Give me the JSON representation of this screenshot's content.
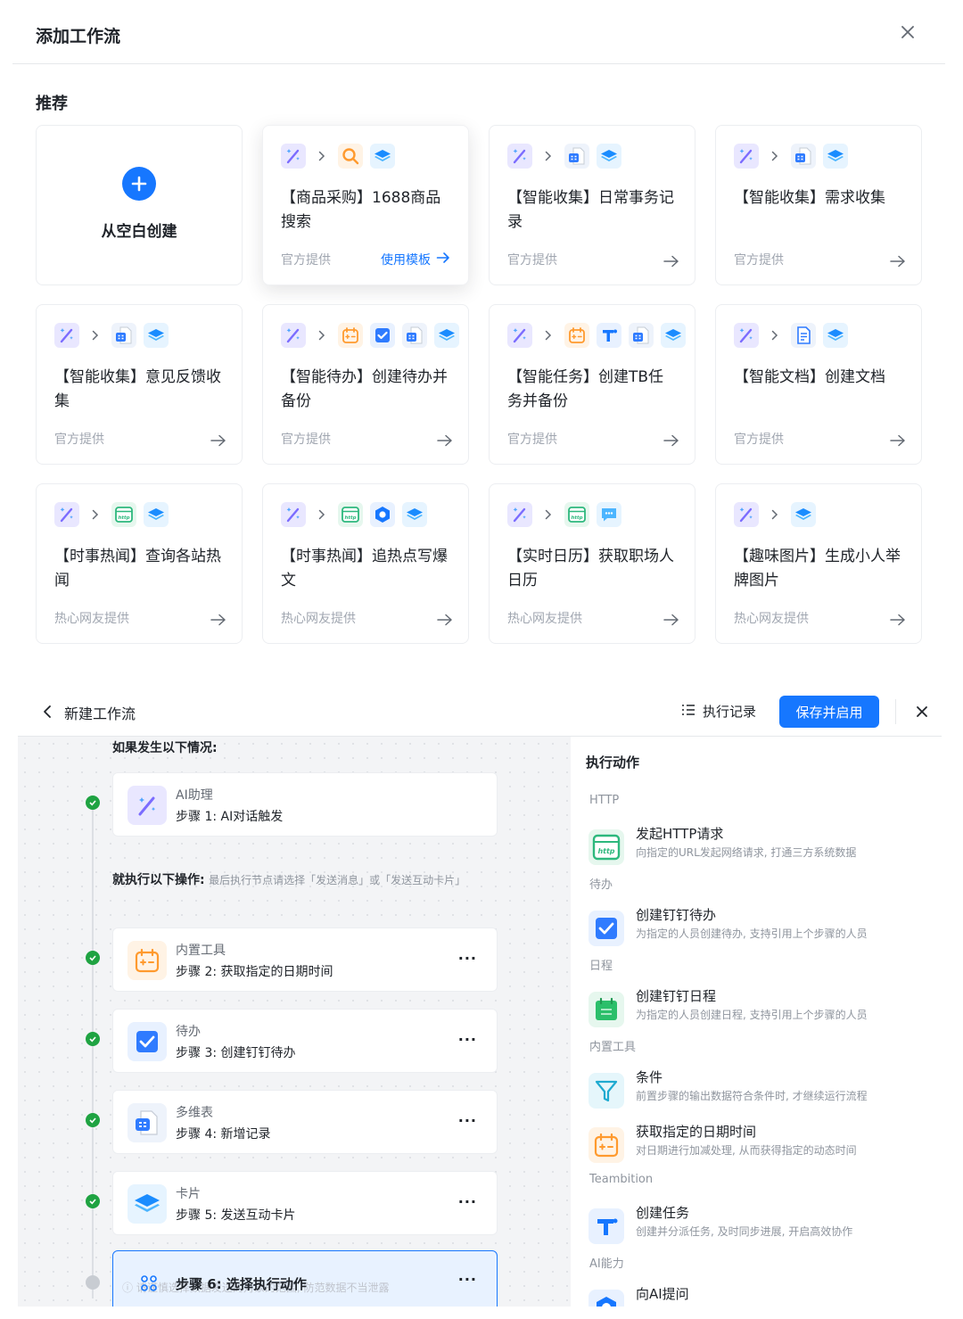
{
  "dialog": {
    "title": "添加工作流",
    "section_title": "推荐",
    "blank_label": "从空白创建",
    "use_template": "使用模板",
    "templates": [
      {
        "title": "【商品采购】1688商品搜索",
        "source": "官方提供",
        "icons": [
          "ai-wand-icon",
          "search-icon",
          "card-icon"
        ]
      },
      {
        "title": "【智能收集】日常事务记录",
        "source": "官方提供",
        "icons": [
          "ai-wand-icon",
          "table-icon",
          "card-icon"
        ]
      },
      {
        "title": "【智能收集】需求收集",
        "source": "官方提供",
        "icons": [
          "ai-wand-icon",
          "table-icon",
          "card-icon"
        ]
      },
      {
        "title": "【智能收集】意见反馈收集",
        "source": "官方提供",
        "icons": [
          "ai-wand-icon",
          "table-icon",
          "card-icon"
        ]
      },
      {
        "title": "【智能待办】创建待办并备份",
        "source": "官方提供",
        "icons": [
          "ai-wand-icon",
          "calendar-icon",
          "todo-icon",
          "table-icon",
          "card-icon"
        ]
      },
      {
        "title": "【智能任务】创建TB任务并备份",
        "source": "官方提供",
        "icons": [
          "ai-wand-icon",
          "calendar-icon",
          "teambition-icon",
          "table-icon",
          "card-icon"
        ]
      },
      {
        "title": "【智能文档】创建文档",
        "source": "官方提供",
        "icons": [
          "ai-wand-icon",
          "doc-icon",
          "card-icon"
        ]
      },
      {
        "title": "【时事热闻】查询各站热闻",
        "source": "热心网友提供",
        "icons": [
          "ai-wand-icon",
          "http-icon",
          "card-icon"
        ]
      },
      {
        "title": "【时事热闻】追热点写爆文",
        "source": "热心网友提供",
        "icons": [
          "ai-wand-icon",
          "http-icon",
          "ai-ask-icon",
          "card-icon"
        ]
      },
      {
        "title": "【实时日历】获取职场人日历",
        "source": "热心网友提供",
        "icons": [
          "ai-wand-icon",
          "http-icon",
          "message-icon"
        ]
      },
      {
        "title": "【趣味图片】生成小人举牌图片",
        "source": "热心网友提供",
        "icons": [
          "ai-wand-icon",
          "card-icon"
        ]
      }
    ]
  },
  "editor": {
    "title": "新建工作流",
    "exec_log": "执行记录",
    "save_button": "保存并启用",
    "condition_label": "如果发生以下情况:",
    "exec_label": "就执行以下操作:",
    "exec_hint": "最后执行节点请选择「发送消息」或「发送互动卡片」",
    "steps": [
      {
        "type": "AI助理",
        "name": "步骤 1: AI对话触发"
      },
      {
        "type": "内置工具",
        "name": "步骤 2: 获取指定的日期时间"
      },
      {
        "type": "待办",
        "name": "步骤 3: 创建钉钉待办"
      },
      {
        "type": "多维表",
        "name": "步骤 4: 新增记录"
      },
      {
        "type": "卡片",
        "name": "步骤 5: 发送互动卡片"
      },
      {
        "type": "",
        "name": "步骤 6: 选择执行动作"
      }
    ],
    "warning_text": "ⓘ 请谨慎选择数据发送的对象的范围, 防范数据不当泄露",
    "more": "···"
  },
  "panel": {
    "title": "执行动作",
    "groups": [
      {
        "label": "HTTP",
        "actions": [
          {
            "name": "发起HTTP请求",
            "desc": "向指定的URL发起网络请求, 打通三方系统数据"
          }
        ]
      },
      {
        "label": "待办",
        "actions": [
          {
            "name": "创建钉钉待办",
            "desc": "为指定的人员创建待办, 支持引用上个步骤的人员"
          }
        ]
      },
      {
        "label": "日程",
        "actions": [
          {
            "name": "创建钉钉日程",
            "desc": "为指定的人员创建日程, 支持引用上个步骤的人员"
          }
        ]
      },
      {
        "label": "内置工具",
        "actions": [
          {
            "name": "条件",
            "desc": "前置步骤的输出数据符合条件时, 才继续运行流程"
          },
          {
            "name": "获取指定的日期时间",
            "desc": "对日期进行加减处理, 从而获得指定的动态时间"
          }
        ]
      },
      {
        "label": "Teambition",
        "actions": [
          {
            "name": "创建任务",
            "desc": "创建并分派任务, 及时同步进展, 开启高效协作"
          }
        ]
      },
      {
        "label": "AI能力",
        "actions": [
          {
            "name": "向AI提问",
            "desc": ""
          }
        ]
      }
    ]
  },
  "colors": {
    "primary": "#1677ff",
    "success": "#1fa342",
    "orange": "#ff9a2e",
    "teal": "#2db87d"
  }
}
